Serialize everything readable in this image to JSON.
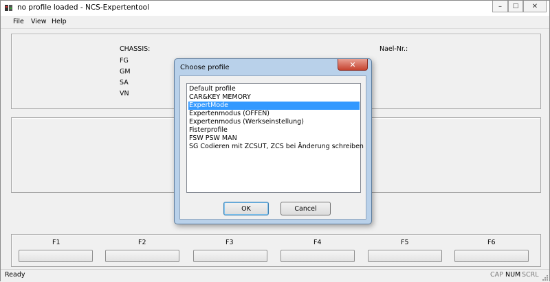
{
  "window": {
    "title": "no profile loaded - NCS-Expertentool"
  },
  "menu": {
    "items": [
      "File",
      "View",
      "Help"
    ]
  },
  "info": {
    "chassis_label": "CHASSIS:",
    "fg_label": "FG",
    "gm_label": "GM",
    "sa_label": "SA",
    "vn_label": "VN",
    "nael_label": "Nael-Nr.:"
  },
  "fkeys": [
    "F1",
    "F2",
    "F3",
    "F4",
    "F5",
    "F6"
  ],
  "status": {
    "text": "Ready",
    "indicators": [
      {
        "label": "CAP",
        "active": false
      },
      {
        "label": "NUM",
        "active": true
      },
      {
        "label": "SCRL",
        "active": false
      }
    ]
  },
  "dialog": {
    "title": "Choose profile",
    "profiles": [
      "Default profile",
      "CAR&KEY MEMORY",
      "ExpertMode",
      "Expertenmodus (OFFEN)",
      "Expertenmodus (Werkseinstellung)",
      "Fisterprofile",
      "FSW PSW MAN",
      "SG Codieren mit ZCSUT, ZCS bei Änderung schreiben"
    ],
    "selected_index": 2,
    "ok_label": "OK",
    "cancel_label": "Cancel"
  }
}
